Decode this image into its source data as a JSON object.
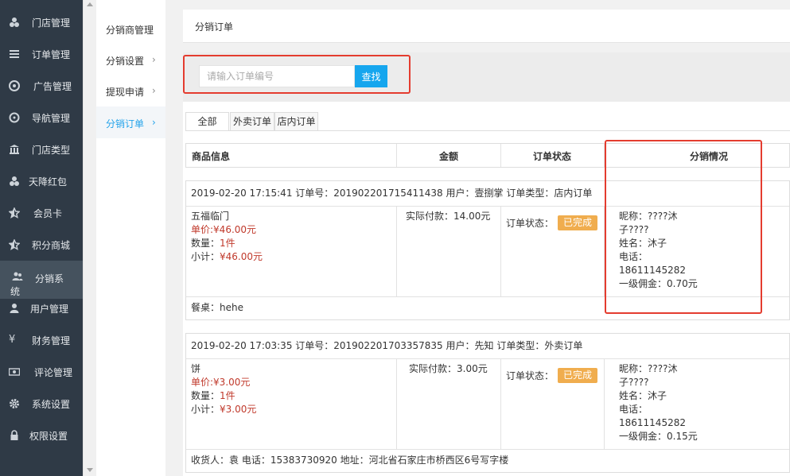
{
  "sidebar": {
    "items": [
      {
        "label": "门店管理",
        "icon": "cubes-icon"
      },
      {
        "label": "订单管理",
        "icon": "list-icon"
      },
      {
        "label": "广告管理",
        "icon": "lifebuoy-icon"
      },
      {
        "label": "导航管理",
        "icon": "compass-icon"
      },
      {
        "label": "门店类型",
        "icon": "bank-icon"
      },
      {
        "label": "天降红包",
        "icon": "cubes-icon"
      },
      {
        "label": "会员卡",
        "icon": "star-half-icon"
      },
      {
        "label": "积分商城",
        "icon": "star-half-icon"
      },
      {
        "label": "分销系",
        "label2": "统",
        "icon": "users-icon"
      },
      {
        "label": "用户管理",
        "icon": "user-icon"
      },
      {
        "label": "财务管理",
        "icon": "yen-icon"
      },
      {
        "label": "评论管理",
        "icon": "money-icon"
      },
      {
        "label": "系统设置",
        "icon": "gear-icon"
      },
      {
        "label": "权限设置",
        "icon": "lock-icon"
      }
    ]
  },
  "submenu": {
    "items": [
      {
        "label": "分销商管理",
        "arrow": ""
      },
      {
        "label": "分销设置",
        "arrow": "›"
      },
      {
        "label": "提现申请",
        "arrow": "›"
      },
      {
        "label": "分销订单",
        "arrow": "›"
      }
    ]
  },
  "page": {
    "title": "分销订单"
  },
  "search": {
    "placeholder": "请输入订单编号",
    "button": "查找"
  },
  "tabs": [
    "全部",
    "外卖订单",
    "店内订单"
  ],
  "table_header": {
    "product": "商品信息",
    "amount": "金额",
    "status": "订单状态",
    "distribution": "分销情况"
  },
  "orders": [
    {
      "summary": "2019-02-20 17:15:41 订单号：201902201715411438 用户：壹捌掌 订单类型：店内订单",
      "product_name": "五福临门",
      "price_label": "单价:",
      "price": "¥46.00元",
      "qty_label": "数量：",
      "qty": "1件",
      "subtotal_label": "小计：",
      "subtotal": "¥46.00元",
      "paid": "实际付款：14.00元",
      "status_label": "订单状态：",
      "status": "已完成",
      "dist_lines": [
        "昵称：????沐",
        "子????",
        "姓名：沐子",
        "电话：",
        "18611145282",
        "一级佣金：0.70元"
      ],
      "footer": "餐桌：hehe"
    },
    {
      "summary": "2019-02-20 17:03:35 订单号：201902201703357835 用户：先知 订单类型：外卖订单",
      "product_name": "饼",
      "price_label": "单价:",
      "price": "¥3.00元",
      "qty_label": "数量：",
      "qty": "1件",
      "subtotal_label": "小计：",
      "subtotal": "¥3.00元",
      "paid": "实际付款：3.00元",
      "status_label": "订单状态：",
      "status": "已完成",
      "dist_lines": [
        "昵称：????沐",
        "子????",
        "姓名：沐子",
        "电话：",
        "18611145282",
        "一级佣金：0.15元"
      ],
      "footer": "收货人：袁 电话：15383730920 地址：河北省石家庄市桥西区6号写字楼"
    }
  ],
  "colors": {
    "sidebar_bg": "#2f3a46",
    "accent": "#16a6ee",
    "badge": "#f0ad4e",
    "highlight_red": "#e43c2f"
  }
}
